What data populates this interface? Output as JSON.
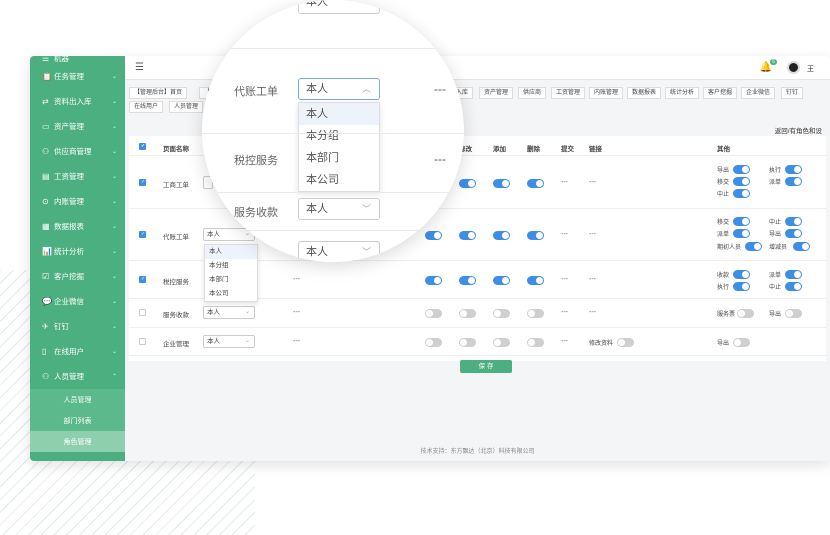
{
  "sidebar": {
    "top_partial": "机器",
    "items": [
      {
        "icon": "📋",
        "label": "任务管理"
      },
      {
        "icon": "⇄",
        "label": "资料出入库"
      },
      {
        "icon": "▭",
        "label": "资产管理"
      },
      {
        "icon": "⚇",
        "label": "供应商管理"
      },
      {
        "icon": "▤",
        "label": "工资管理"
      },
      {
        "icon": "⊙",
        "label": "内账管理"
      },
      {
        "icon": "▦",
        "label": "数据报表"
      },
      {
        "icon": "📊",
        "label": "统计分析"
      },
      {
        "icon": "☑",
        "label": "客户挖掘"
      },
      {
        "icon": "💬",
        "label": "企业微信"
      },
      {
        "icon": "✈",
        "label": "钉钉"
      },
      {
        "icon": "▯",
        "label": "在线用户"
      },
      {
        "icon": "⚇",
        "label": "人员管理"
      }
    ],
    "sub_items": [
      "人员管理",
      "部门列表",
      "角色管理"
    ]
  },
  "topbar": {
    "notify_count": "6",
    "user_name": "王"
  },
  "tabs_row1": [
    "【管理后台】首页",
    "【",
    "出入库",
    "资产管理",
    "供应商",
    "工资管理",
    "内账管理",
    "数据报表",
    "统计分析",
    "客户挖掘",
    "企业微信",
    "钉钉"
  ],
  "tabs_row2": [
    "在线用户",
    "人员管理"
  ],
  "right_link": "返回/有角色和设",
  "table": {
    "headers": {
      "name": "页面名称",
      "modify": "修改",
      "add": "添加",
      "delete": "删除",
      "submit": "提交",
      "link": "链接",
      "other": "其他"
    },
    "rows": [
      {
        "name": "工商工单",
        "scope": "本人",
        "checked": true,
        "dash1": "---",
        "dash2": "---",
        "other": [
          {
            "label": "导出",
            "on": true
          },
          {
            "label": "执行",
            "on": true
          },
          {
            "label": "移交",
            "on": true
          },
          {
            "label": "派单",
            "on": true
          },
          {
            "label": "中止",
            "on": true
          }
        ]
      },
      {
        "name": "代账工单",
        "scope": "本人",
        "checked": true,
        "dash1": "---",
        "dash2": "---",
        "other": [
          {
            "label": "移交",
            "on": true
          },
          {
            "label": "中止",
            "on": true
          },
          {
            "label": "派单",
            "on": true
          },
          {
            "label": "导出",
            "on": true
          },
          {
            "label": "期初人员",
            "on": true
          },
          {
            "label": "增减员",
            "on": true
          }
        ]
      },
      {
        "name": "税控服务",
        "scope": "",
        "checked": true,
        "dash1": "---",
        "dash2": "---",
        "other": [
          {
            "label": "收款",
            "on": true
          },
          {
            "label": "派单",
            "on": true
          },
          {
            "label": "执行",
            "on": true
          },
          {
            "label": "中止",
            "on": true
          }
        ]
      },
      {
        "name": "服务收款",
        "scope": "本人",
        "checked": false,
        "dash1": "---",
        "dash2": "---",
        "other": [
          {
            "label": "服务票",
            "on": false
          },
          {
            "label": "导出",
            "on": false
          }
        ]
      },
      {
        "name": "企业管理",
        "scope": "本人",
        "checked": false,
        "dash1": "---",
        "extra": "修改资料",
        "other": [
          {
            "label": "导出",
            "on": false
          }
        ]
      }
    ],
    "dropdown_options": [
      "本人",
      "本分组",
      "本部门",
      "本公司"
    ]
  },
  "save_label": "保 存",
  "footer": "技术支持：东方飘达（北京）科技有限公司",
  "magnifier": {
    "top_value": "本人",
    "label_daizhang": "代账工单",
    "label_shuikong": "税控服务",
    "label_fuwu": "服务收款",
    "select_value": "本人",
    "select_value2": "本人",
    "select_value3": "本人",
    "options": [
      "本人",
      "本分组",
      "本部门",
      "本公司"
    ],
    "dash": "---"
  }
}
